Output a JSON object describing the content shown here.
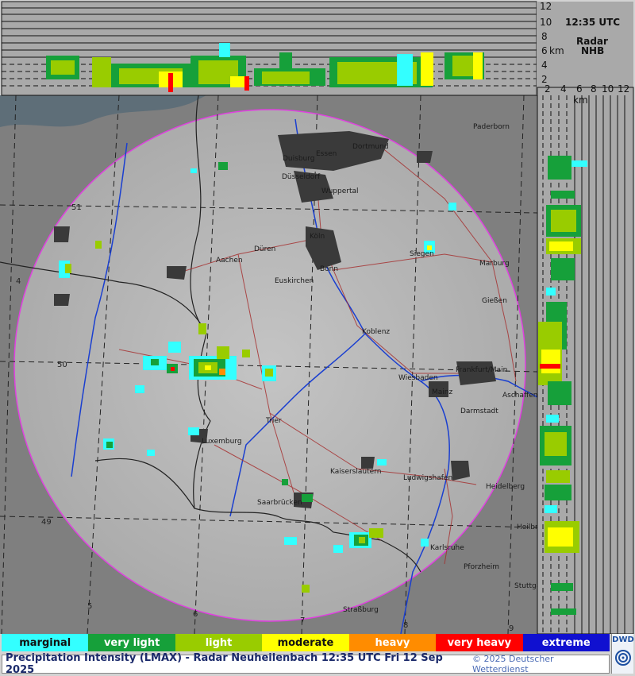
{
  "time_label": "12:35 UTC",
  "radar_label": "Radar",
  "station_code": "NHB",
  "top_axis_unit": "km",
  "right_axis_unit": "km",
  "height_ticks": [
    "12",
    "10",
    "8",
    "6",
    "4",
    "2"
  ],
  "right_ticks": [
    "2",
    "4",
    "6",
    "8",
    "10",
    "12"
  ],
  "grid_labels": {
    "lat": [
      "51",
      "50",
      "49"
    ],
    "lon": [
      "4",
      "5",
      "6",
      "7",
      "8",
      "9"
    ]
  },
  "cities": [
    {
      "name": "Paderborn"
    },
    {
      "name": "Essen"
    },
    {
      "name": "Dortmund"
    },
    {
      "name": "Duisburg"
    },
    {
      "name": "Düsseldorf"
    },
    {
      "name": "Wuppertal"
    },
    {
      "name": "Köln"
    },
    {
      "name": "Siegen"
    },
    {
      "name": "Aachen"
    },
    {
      "name": "Düren"
    },
    {
      "name": "Bonn"
    },
    {
      "name": "Euskirchen"
    },
    {
      "name": "Marburg"
    },
    {
      "name": "Gießen"
    },
    {
      "name": "Koblenz"
    },
    {
      "name": "Wiesbaden"
    },
    {
      "name": "Frankfurt/Main"
    },
    {
      "name": "Mainz"
    },
    {
      "name": "Aschaffenburg"
    },
    {
      "name": "Darmstadt"
    },
    {
      "name": "Trier"
    },
    {
      "name": "Luxemburg"
    },
    {
      "name": "Kaiserslautern"
    },
    {
      "name": "Ludwigshafen"
    },
    {
      "name": "Heidelberg"
    },
    {
      "name": "Saarbrücken"
    },
    {
      "name": "Heilbronn"
    },
    {
      "name": "Karlsruhe"
    },
    {
      "name": "Pforzheim"
    },
    {
      "name": "Stuttgart"
    },
    {
      "name": "Straßburg"
    }
  ],
  "legend": [
    {
      "label": "marginal",
      "color": "#33ffff"
    },
    {
      "label": "very light",
      "color": "#16a03a"
    },
    {
      "label": "light",
      "color": "#99cc00"
    },
    {
      "label": "moderate",
      "color": "#ffff00"
    },
    {
      "label": "heavy",
      "color": "#ff8c00"
    },
    {
      "label": "very heavy",
      "color": "#ff0000"
    },
    {
      "label": "extreme",
      "color": "#1010d0"
    }
  ],
  "footer": {
    "title": "Precipitation Intensity (LMAX) - Radar Neuheilenbach 12:35 UTC Fri 12 Sep 2025",
    "copyright": "© 2025 Deutscher Wetterdienst"
  },
  "logo_text": "DWD",
  "colors": {
    "range_ring": "#e040e0",
    "roads": "#a52a2a",
    "borders": "#222222",
    "rivers": "#1a3fd0"
  }
}
